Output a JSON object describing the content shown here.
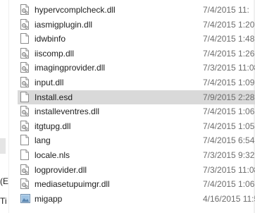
{
  "left_pane": {
    "cut_label_1": "(E",
    "cut_label_2": "Ti"
  },
  "files": [
    {
      "name": "hypervcomplcheck.dll",
      "date": "7/4/2015 11:",
      "type": "dll-icon",
      "selected": false
    },
    {
      "name": "iasmigplugin.dll",
      "date": "7/4/2015 1:20",
      "type": "dll-icon",
      "selected": false
    },
    {
      "name": "idwbinfo",
      "date": "7/4/2015 1:48",
      "type": "file-icon",
      "selected": false
    },
    {
      "name": "iiscomp.dll",
      "date": "7/4/2015 1:26",
      "type": "dll-icon",
      "selected": false
    },
    {
      "name": "imagingprovider.dll",
      "date": "7/3/2015 11:08",
      "type": "dll-icon",
      "selected": false
    },
    {
      "name": "input.dll",
      "date": "7/4/2015 1:09",
      "type": "dll-icon",
      "selected": false
    },
    {
      "name": "Install.esd",
      "date": "7/9/2015 2:28",
      "type": "file-icon",
      "selected": true
    },
    {
      "name": "installeventres.dll",
      "date": "7/4/2015 1:06",
      "type": "dll-icon",
      "selected": false
    },
    {
      "name": "itgtupg.dll",
      "date": "7/4/2015 1:05",
      "type": "dll-icon",
      "selected": false
    },
    {
      "name": "lang",
      "date": "7/4/2015 6:54",
      "type": "file-icon",
      "selected": false
    },
    {
      "name": "locale.nls",
      "date": "7/3/2015 9:32",
      "type": "file-icon",
      "selected": false
    },
    {
      "name": "logprovider.dll",
      "date": "7/3/2015 11:08",
      "type": "dll-icon",
      "selected": false
    },
    {
      "name": "mediasetupuimgr.dll",
      "date": "7/4/2015 1:06",
      "type": "dll-icon",
      "selected": false
    },
    {
      "name": "migapp",
      "date": "4/16/2015 11:5",
      "type": "image-icon",
      "selected": false
    }
  ]
}
